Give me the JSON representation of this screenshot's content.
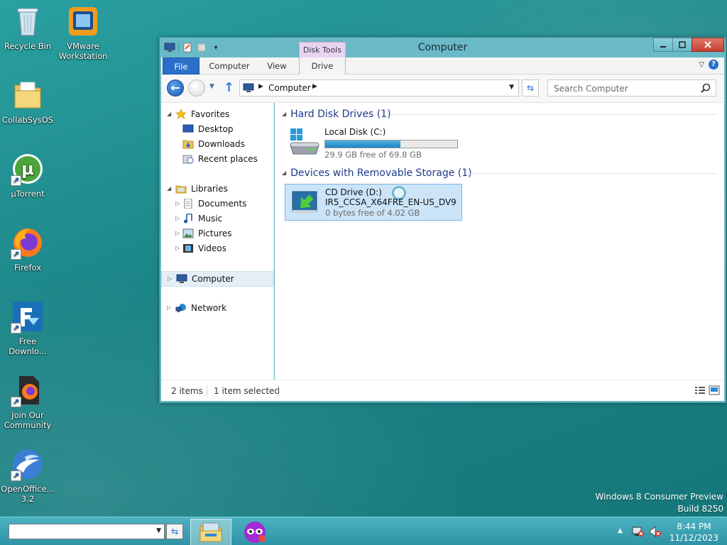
{
  "desktop": {
    "icons": [
      {
        "label": "Recycle Bin",
        "icon": "recycle-bin-icon"
      },
      {
        "label": "VMware Workstation",
        "icon": "vmware-icon"
      },
      {
        "label": "CollabSysOS",
        "icon": "folder-icon"
      },
      {
        "label": "µTorrent",
        "icon": "utorrent-icon"
      },
      {
        "label": "Firefox",
        "icon": "firefox-icon"
      },
      {
        "label": "Free Downlo...",
        "icon": "free-download-manager-icon"
      },
      {
        "label": "Join Our Community",
        "icon": "firefox-document-icon"
      },
      {
        "label": "OpenOffice... 3.2",
        "icon": "openoffice-icon"
      }
    ],
    "watermark": {
      "line1": "Windows 8 Consumer Preview",
      "line2": "Build 8250"
    }
  },
  "window": {
    "title": "Computer",
    "context_tab_group": "Disk Tools",
    "tabs": {
      "file": "File",
      "computer": "Computer",
      "view": "View",
      "drive": "Drive"
    },
    "address": {
      "location": "Computer"
    },
    "search": {
      "placeholder": "Search Computer"
    },
    "nav": {
      "favorites": "Favorites",
      "desktop": "Desktop",
      "downloads": "Downloads",
      "recent_places": "Recent places",
      "libraries": "Libraries",
      "documents": "Documents",
      "music": "Music",
      "pictures": "Pictures",
      "videos": "Videos",
      "computer": "Computer",
      "network": "Network"
    },
    "groups": {
      "hard_disk": {
        "title": "Hard Disk Drives (1)",
        "drive": {
          "name": "Local Disk (C:)",
          "free": "29.9 GB free of 69.8 GB",
          "used_fraction": 0.57
        }
      },
      "removable": {
        "title": "Devices with Removable Storage (1)",
        "drive": {
          "name": "CD Drive (D:)",
          "label": "IR5_CCSA_X64FRE_EN-US_DV9",
          "free": "0 bytes free of 4.02 GB"
        }
      }
    },
    "status": {
      "items": "2 items",
      "selected": "1 item selected"
    }
  },
  "taskbar": {
    "clock_time": "8:44 PM",
    "clock_date": "11/12/2023"
  },
  "colors": {
    "accent": "#2a6fc9",
    "selection": "#cce4f7",
    "header": "#1e3a8a"
  }
}
